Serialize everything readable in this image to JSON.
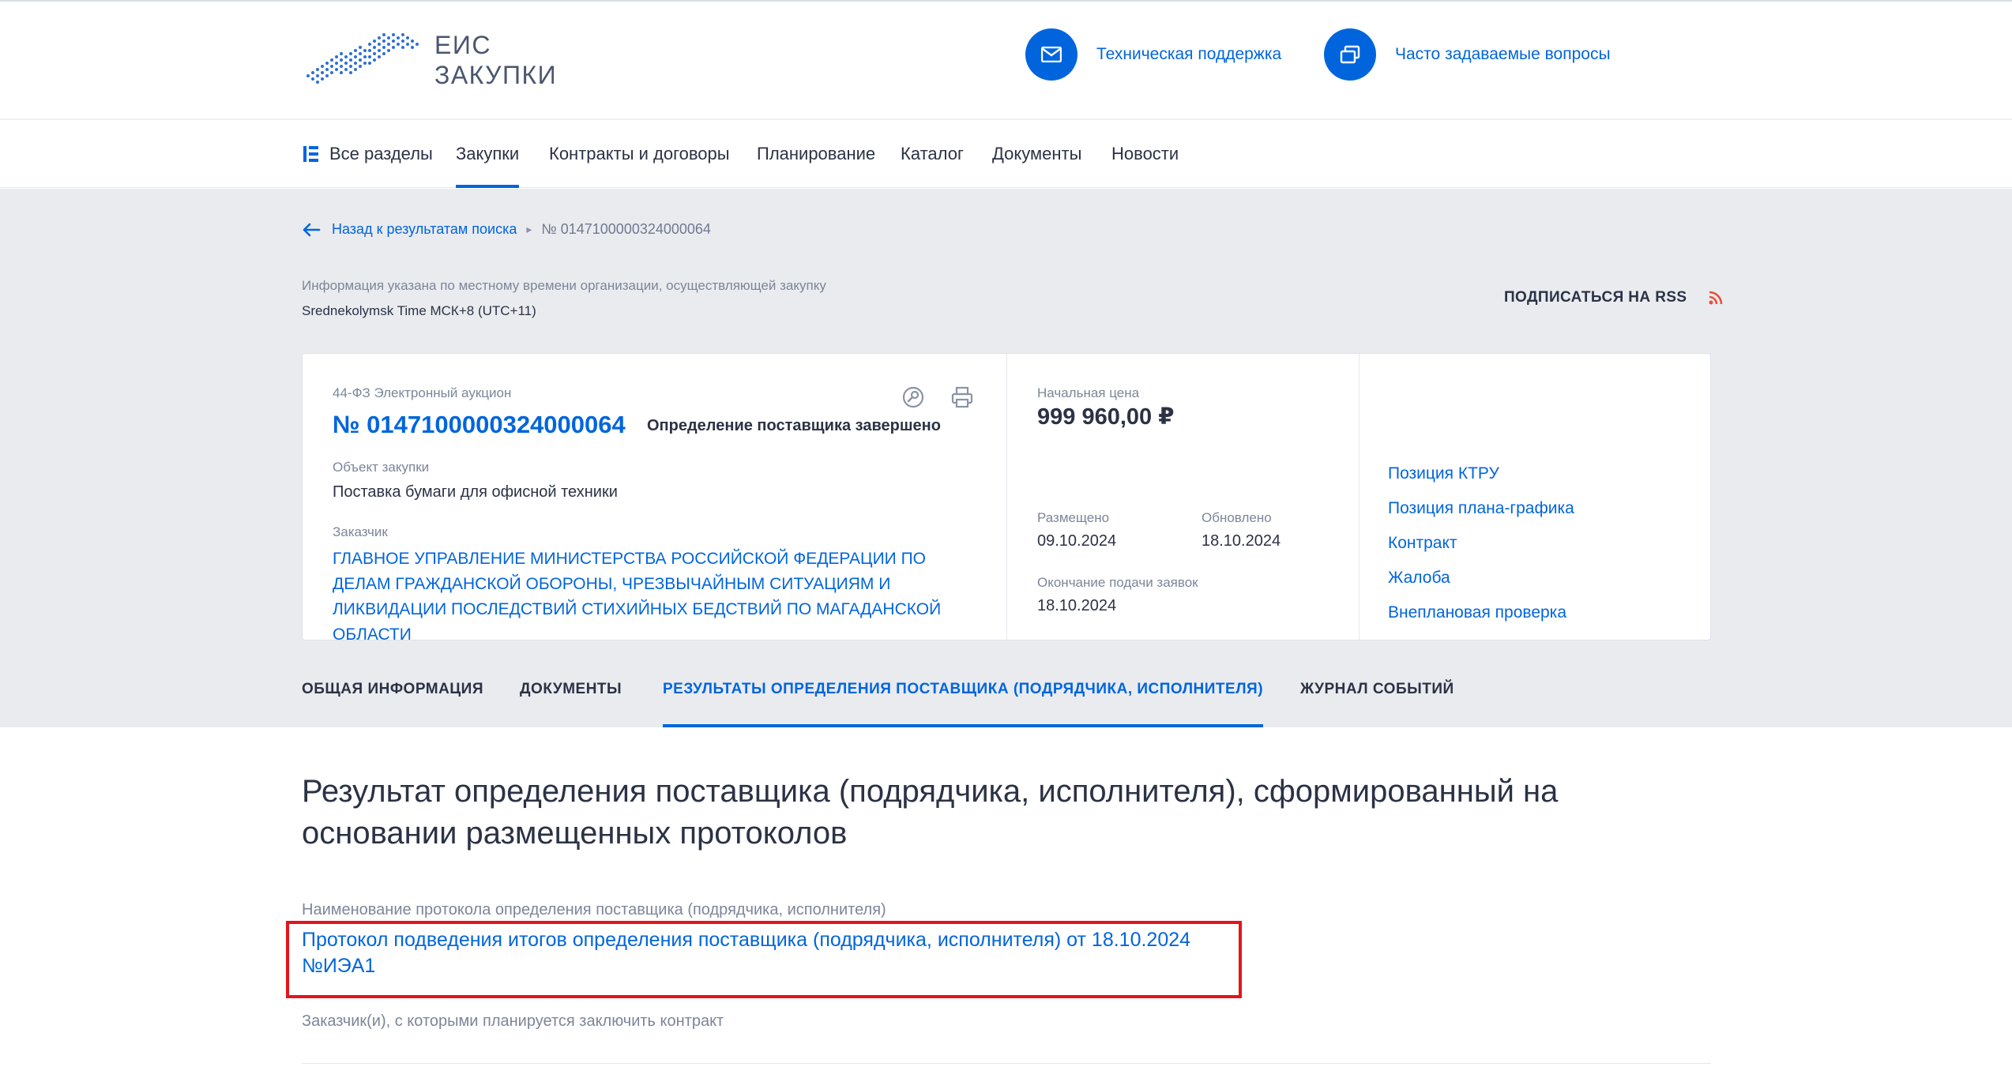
{
  "logo": {
    "line1": "ЕИС",
    "line2": "ЗАКУПКИ"
  },
  "header": {
    "support": "Техническая поддержка",
    "faq": "Часто задаваемые вопросы"
  },
  "nav": {
    "all": "Все разделы",
    "items": [
      "Закупки",
      "Контракты и договоры",
      "Планирование",
      "Каталог",
      "Документы",
      "Новости"
    ],
    "active_index": 0
  },
  "breadcrumb": {
    "back": "Назад к результатам поиска",
    "separator": "▸",
    "current": "№ 0147100000324000064"
  },
  "timezone": {
    "note": "Информация указана по местному времени организации, осуществляющей закупку",
    "value": "Srednekolymsk Time МСК+8 (UTC+11)"
  },
  "rss": {
    "label": "ПОДПИСАТЬСЯ НА RSS"
  },
  "card": {
    "type": "44-ФЗ Электронный аукцион",
    "number": "№ 0147100000324000064",
    "status": "Определение поставщика завершено",
    "object_label": "Объект закупки",
    "object_value": "Поставка бумаги для офисной техники",
    "customer_label": "Заказчик",
    "customer_value": "ГЛАВНОЕ УПРАВЛЕНИЕ МИНИСТЕРСТВА РОССИЙСКОЙ ФЕДЕРАЦИИ ПО ДЕЛАМ ГРАЖДАНСКОЙ ОБОРОНЫ, ЧРЕЗВЫЧАЙНЫМ СИТУАЦИЯМ И ЛИКВИДАЦИИ ПОСЛЕДСТВИЙ СТИХИЙНЫХ БЕДСТВИЙ ПО МАГАДАНСКОЙ ОБЛАСТИ",
    "price_label": "Начальная цена",
    "price_value": "999 960,00 ₽",
    "published_label": "Размещено",
    "published_value": "09.10.2024",
    "updated_label": "Обновлено",
    "updated_value": "18.10.2024",
    "deadline_label": "Окончание подачи заявок",
    "deadline_value": "18.10.2024",
    "links": [
      "Позиция КТРУ",
      "Позиция плана-графика",
      "Контракт",
      "Жалоба",
      "Внеплановая проверка"
    ]
  },
  "tabs": {
    "items": [
      "ОБЩАЯ ИНФОРМАЦИЯ",
      "ДОКУМЕНТЫ",
      "РЕЗУЛЬТАТЫ ОПРЕДЕЛЕНИЯ ПОСТАВЩИКА (ПОДРЯДЧИКА, ИСПОЛНИТЕЛЯ)",
      "ЖУРНАЛ СОБЫТИЙ"
    ],
    "active_index": 2
  },
  "content": {
    "heading": "Результат определения поставщика (подрядчика, исполнителя), сформированный на основании размещенных протоколов",
    "protocol_label": "Наименование протокола определения поставщика (подрядчика, исполнителя)",
    "protocol_link": "Протокол подведения итогов определения поставщика (подрядчика, исполнителя) от 18.10.2024 №ИЭА1",
    "customers_label": "Заказчик(и), с которыми планируется заключить контракт"
  },
  "colors": {
    "accent": "#0065dd",
    "text": "#2b3245",
    "muted": "#7c8699",
    "gray_bg": "#e9ebef",
    "highlight": "#e4141c",
    "rss": "#e8503a"
  },
  "icons": [
    "russia-map-logo",
    "mail-icon",
    "faq-icon",
    "sections-icon",
    "arrow-left-icon",
    "search-key-icon",
    "print-icon",
    "rss-icon"
  ]
}
